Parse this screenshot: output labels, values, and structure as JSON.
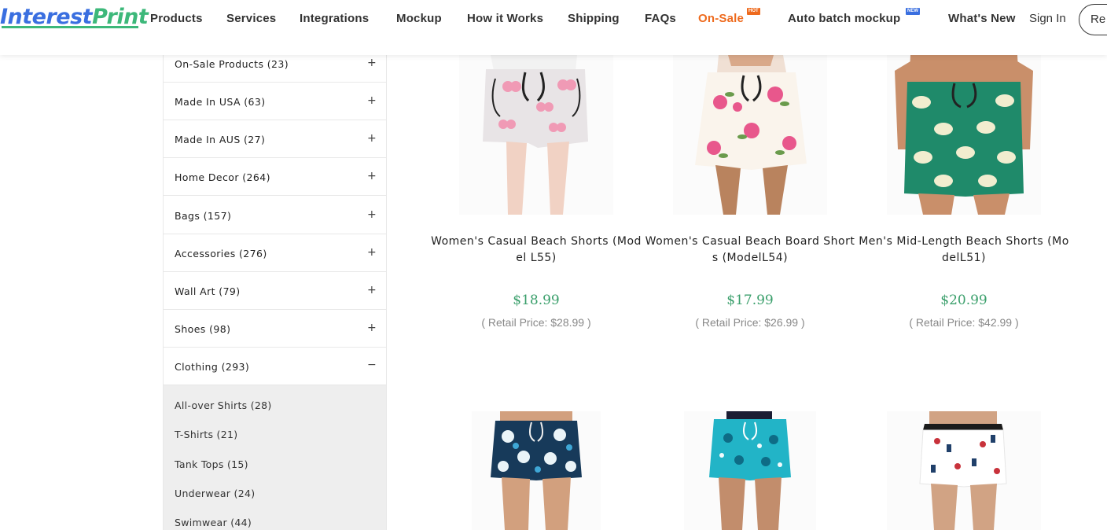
{
  "header": {
    "logo_part1": "Interest",
    "logo_part2": "Print",
    "nav": [
      {
        "label": "Products"
      },
      {
        "label": "Services"
      },
      {
        "label": "Integrations"
      },
      {
        "label": "Mockup"
      },
      {
        "label": "How it Works"
      },
      {
        "label": "Shipping"
      },
      {
        "label": "FAQs"
      },
      {
        "label": "On-Sale",
        "badge": "HOT"
      },
      {
        "label": "Auto batch mockup",
        "badge": "NEW"
      },
      {
        "label": "What's New"
      }
    ],
    "sign_in": "Sign In",
    "register_partial": "Re"
  },
  "sidebar": {
    "categories": [
      {
        "label": "On-Sale Products (23)",
        "sign": "+"
      },
      {
        "label": "Made In USA (63)",
        "sign": "+"
      },
      {
        "label": "Made In AUS (27)",
        "sign": "+"
      },
      {
        "label": "Home Decor (264)",
        "sign": "+"
      },
      {
        "label": "Bags (157)",
        "sign": "+"
      },
      {
        "label": "Accessories (276)",
        "sign": "+"
      },
      {
        "label": "Wall Art (79)",
        "sign": "+"
      },
      {
        "label": "Shoes (98)",
        "sign": "+"
      },
      {
        "label": "Clothing (293)",
        "sign": "−"
      }
    ],
    "clothing_sub": [
      {
        "label": "All-over Shirts (28)"
      },
      {
        "label": "T-Shirts (21)"
      },
      {
        "label": "Tank Tops (15)"
      },
      {
        "label": "Underwear (24)"
      },
      {
        "label": "Swimwear (44)"
      }
    ]
  },
  "products": [
    {
      "name": "Women's Casual Beach Shorts (Model L55)",
      "price": "$18.99",
      "retail": "( Retail Price: $28.99 )",
      "pattern": "pink bows on light grey"
    },
    {
      "name": "Women's Casual Beach Board Shorts (ModelL54)",
      "price": "$17.99",
      "retail": "( Retail Price: $26.99 )",
      "pattern": "pink roses on cream"
    },
    {
      "name": "Men's Mid-Length Beach Shorts (ModelL51)",
      "price": "$20.99",
      "retail": "( Retail Price: $42.99 )",
      "pattern": "cream elephants on green"
    },
    {
      "pattern": "white hibiscus on navy"
    },
    {
      "pattern": "nautical on turquoise"
    },
    {
      "pattern": "nautical on white"
    }
  ],
  "colors": {
    "logo_blue": "#3a6fe0",
    "logo_green": "#3db87a",
    "sale_orange": "#ee6a1d",
    "price_green": "#3a9f6b",
    "sub_panel_bg": "#eeeeee"
  }
}
